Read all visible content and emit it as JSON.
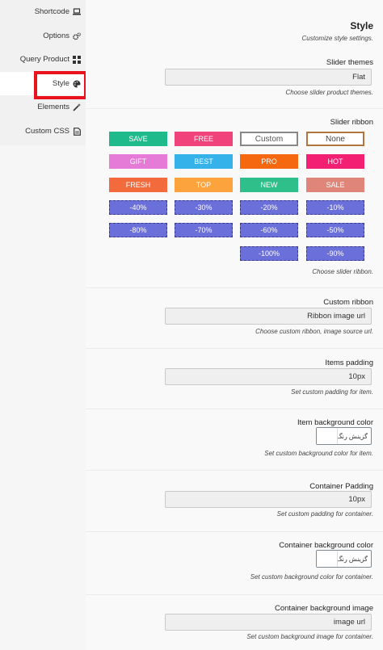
{
  "sidebar": {
    "items": [
      {
        "label": "Shortcode",
        "icon": "laptop-icon"
      },
      {
        "label": "Options",
        "icon": "cogs-icon"
      },
      {
        "label": "Query Product",
        "icon": "grid-icon"
      },
      {
        "label": "Style",
        "icon": "palette-icon"
      },
      {
        "label": "Elements",
        "icon": "magic-wand-icon"
      },
      {
        "label": "Custom CSS",
        "icon": "file-icon"
      }
    ],
    "active": "Style",
    "highlight_color": "#e8131d"
  },
  "header": {
    "title": "Style",
    "subtitle": "Customize style settings."
  },
  "slider_themes": {
    "label": "Slider themes",
    "value": "Flat",
    "desc": "Choose slider product themes."
  },
  "slider_ribbon": {
    "label": "Slider ribbon",
    "desc": "Choose slider ribbon.",
    "options": [
      {
        "label": "SAVE",
        "color": "#1fba8b"
      },
      {
        "label": "FREE",
        "color": "#f0427b"
      },
      {
        "label": "Custom",
        "color": "#ffffff",
        "style": "custom"
      },
      {
        "label": "None",
        "color": "#ffffff",
        "style": "none"
      },
      {
        "label": "GIFT",
        "color": "#e57bd6"
      },
      {
        "label": "BEST",
        "color": "#34b2e9"
      },
      {
        "label": "PRO",
        "color": "#f5680f"
      },
      {
        "label": "HOT",
        "color": "#f21f72"
      },
      {
        "label": "FRESH",
        "color": "#f36b3c"
      },
      {
        "label": "TOP",
        "color": "#fca33d"
      },
      {
        "label": "NEW",
        "color": "#2ebf8a"
      },
      {
        "label": "SALE",
        "color": "#e0857a"
      },
      {
        "label": "-40%",
        "color": "#6b6fd9"
      },
      {
        "label": "-30%",
        "color": "#6b6fd9"
      },
      {
        "label": "-20%",
        "color": "#6b6fd9"
      },
      {
        "label": "-10%",
        "color": "#6b6fd9"
      },
      {
        "label": "-80%",
        "color": "#6b6fd9"
      },
      {
        "label": "-70%",
        "color": "#6b6fd9"
      },
      {
        "label": "-60%",
        "color": "#6b6fd9"
      },
      {
        "label": "-50%",
        "color": "#6b6fd9"
      },
      {
        "label": "-100%",
        "color": "#6b6fd9"
      },
      {
        "label": "-90%",
        "color": "#6b6fd9"
      }
    ]
  },
  "custom_ribbon": {
    "label": "Custom ribbon",
    "placeholder": "Ribbon image url",
    "desc": "Choose custom ribbon, image source url."
  },
  "items_padding": {
    "label": "Items padding",
    "value": "10px",
    "desc": "Set custom padding for item."
  },
  "item_bg_color": {
    "label": "Item background color",
    "button": "گزینش رنگ",
    "desc": "Set custom background color for item."
  },
  "container_padding": {
    "label": "Container Padding",
    "value": "10px",
    "desc": "Set custom padding for container."
  },
  "container_bg_color": {
    "label": "Container background color",
    "button": "گزینش رنگ",
    "desc": "Set custom background color for container."
  },
  "container_bg_image": {
    "label": "Container background image",
    "placeholder": "image url",
    "desc": "Set custom background image for container."
  }
}
